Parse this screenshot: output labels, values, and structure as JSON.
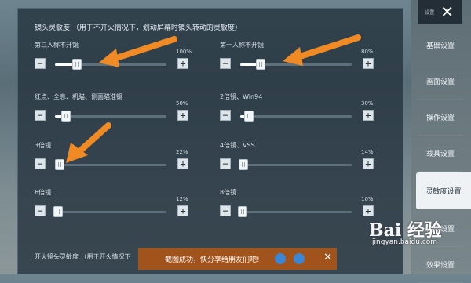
{
  "panel": {
    "title": "镜头灵敏度  （用于不开火情况下，划动屏幕时镜头转动的灵敏度）"
  },
  "sliders": [
    {
      "label": "第三人称不开镜",
      "value_text": "100%",
      "value": 0.2
    },
    {
      "label": "第一人称不开镜",
      "value_text": "80%",
      "value": 0.18
    },
    {
      "label": "红点、全息、机瞄、侧面瞄准镜",
      "value_text": "50%",
      "value": 0.1
    },
    {
      "label": "2倍镜、Win94",
      "value_text": "30%",
      "value": 0.08
    },
    {
      "label": "3倍镜",
      "value_text": "22%",
      "value": 0.04
    },
    {
      "label": "4倍镜、VSS",
      "value_text": "14%",
      "value": 0.03
    },
    {
      "label": "6倍镜",
      "value_text": "12%",
      "value": 0.03
    },
    {
      "label": "8倍镜",
      "value_text": "10%",
      "value": 0.02
    }
  ],
  "buttons": {
    "minus": "−",
    "plus": "+"
  },
  "bottom_section": {
    "title": "开火镜头灵敏度  （用于开火情况下"
  },
  "toast": {
    "message": "截图成功，快分享给朋友们吧!",
    "close": "✕"
  },
  "sidebar": {
    "close_prefix": "设置",
    "close": "✕",
    "items": [
      {
        "label": "基础设置"
      },
      {
        "label": "画面设置"
      },
      {
        "label": "操作设置"
      },
      {
        "label": "载具设置"
      },
      {
        "label": "灵敏度设置"
      },
      {
        "label": "拾取设置"
      },
      {
        "label": "效果设置"
      }
    ]
  },
  "watermark": {
    "main": "Bai 经验",
    "sub": "jingyan.baidu.com"
  },
  "colors": {
    "arrow": "#f08a24",
    "toast_bg": "#b0561a",
    "panel_bg": "#26343f"
  }
}
